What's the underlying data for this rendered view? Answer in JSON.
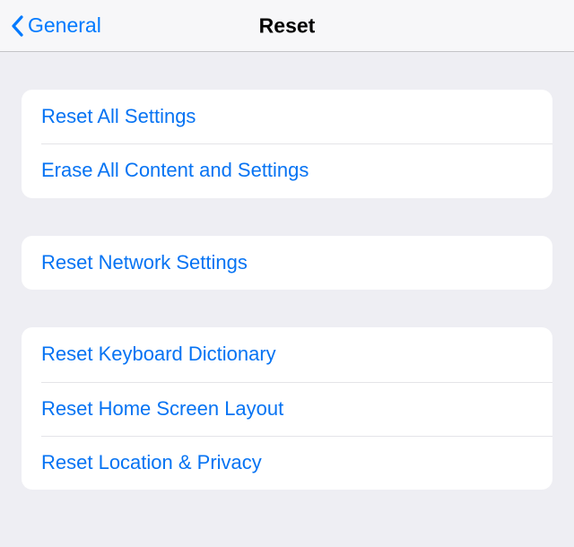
{
  "navbar": {
    "back_label": "General",
    "title": "Reset"
  },
  "groups": [
    {
      "items": [
        {
          "label": "Reset All Settings"
        },
        {
          "label": "Erase All Content and Settings"
        }
      ]
    },
    {
      "items": [
        {
          "label": "Reset Network Settings"
        }
      ]
    },
    {
      "items": [
        {
          "label": "Reset Keyboard Dictionary"
        },
        {
          "label": "Reset Home Screen Layout"
        },
        {
          "label": "Reset Location & Privacy"
        }
      ]
    }
  ]
}
